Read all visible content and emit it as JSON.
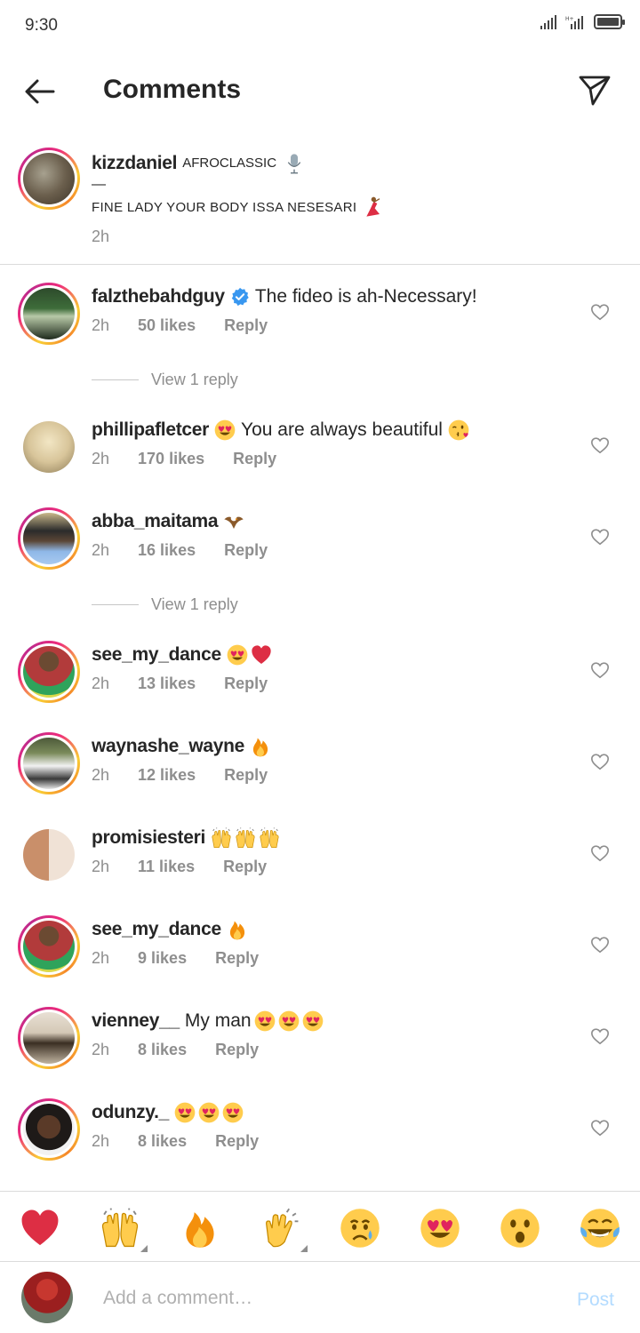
{
  "status_bar": {
    "time": "9:30"
  },
  "header": {
    "title": "Comments"
  },
  "caption": {
    "username": "kizzdaniel",
    "title_text": "AFROCLASSIC",
    "dash": "—",
    "body": "FINE LADY YOUR BODY ISSA NESESARI",
    "time": "2h"
  },
  "comments": [
    {
      "username": "falzthebahdguy",
      "verified": true,
      "text": "The fideo is ah-Necessary!",
      "time": "2h",
      "likes": "50 likes",
      "reply": "Reply"
    },
    {
      "username": "phillipafletcer",
      "text": "You are always beautiful",
      "time": "2h",
      "likes": "170 likes",
      "reply": "Reply"
    },
    {
      "username": "abba_maitama",
      "text": "",
      "time": "2h",
      "likes": "16 likes",
      "reply": "Reply"
    },
    {
      "username": "see_my_dance",
      "text": "",
      "time": "2h",
      "likes": "13 likes",
      "reply": "Reply"
    },
    {
      "username": "waynashe_wayne",
      "text": "",
      "time": "2h",
      "likes": "12 likes",
      "reply": "Reply"
    },
    {
      "username": "promisiesteri",
      "text": "",
      "time": "2h",
      "likes": "11 likes",
      "reply": "Reply"
    },
    {
      "username": "see_my_dance",
      "text": "",
      "time": "2h",
      "likes": "9 likes",
      "reply": "Reply"
    },
    {
      "username": "vienney__",
      "text": "My man",
      "time": "2h",
      "likes": "8 likes",
      "reply": "Reply"
    },
    {
      "username": "odunzy._",
      "text": "",
      "time": "2h",
      "likes": "8 likes",
      "reply": "Reply"
    }
  ],
  "view_replies": [
    "View 1 reply",
    "View 1 reply"
  ],
  "reactions": [
    "red-heart",
    "raising-hands",
    "fire",
    "clapping-hands",
    "crying-face",
    "heart-eyes-face",
    "astonished-face",
    "tears-of-joy-face"
  ],
  "input": {
    "placeholder": "Add a comment…",
    "post_label": "Post"
  },
  "colors": {
    "accent": "#3897f0",
    "post_disabled": "#b3dbff",
    "muted": "#8e8e8e",
    "text": "#262626"
  }
}
